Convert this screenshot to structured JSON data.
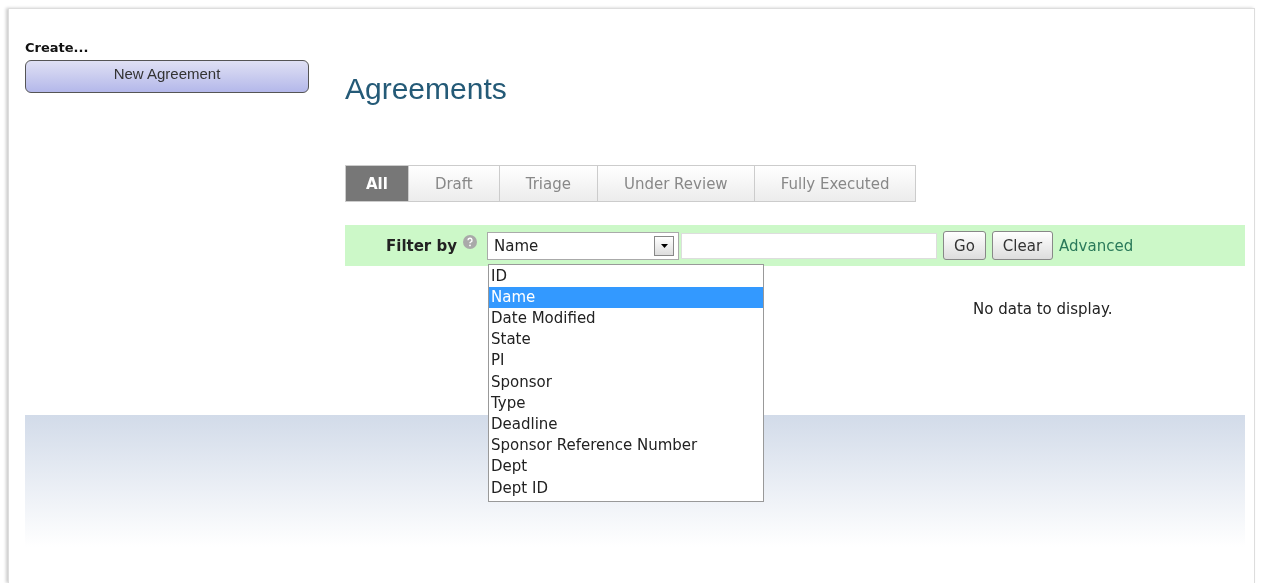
{
  "sidebar": {
    "heading": "Create...",
    "button": "New Agreement"
  },
  "title": "Agreements",
  "tabs": [
    {
      "label": "All",
      "selected": true
    },
    {
      "label": "Draft",
      "selected": false
    },
    {
      "label": "Triage",
      "selected": false
    },
    {
      "label": "Under Review",
      "selected": false
    },
    {
      "label": "Fully Executed",
      "selected": false
    }
  ],
  "filter": {
    "label": "Filter by",
    "select_value": "Name",
    "expanded": true,
    "options": [
      {
        "label": "ID",
        "selected": false
      },
      {
        "label": "Name",
        "selected": true
      },
      {
        "label": "Date Modified",
        "selected": false
      },
      {
        "label": "State",
        "selected": false
      },
      {
        "label": "PI",
        "selected": false
      },
      {
        "label": "Sponsor",
        "selected": false
      },
      {
        "label": "Type",
        "selected": false
      },
      {
        "label": "Deadline",
        "selected": false
      },
      {
        "label": "Sponsor Reference Number",
        "selected": false
      },
      {
        "label": "Dept",
        "selected": false
      },
      {
        "label": "Dept ID",
        "selected": false
      }
    ],
    "buttons": [
      "Go",
      "Clear"
    ],
    "link": "Advanced"
  },
  "empty_message": "No data to display."
}
